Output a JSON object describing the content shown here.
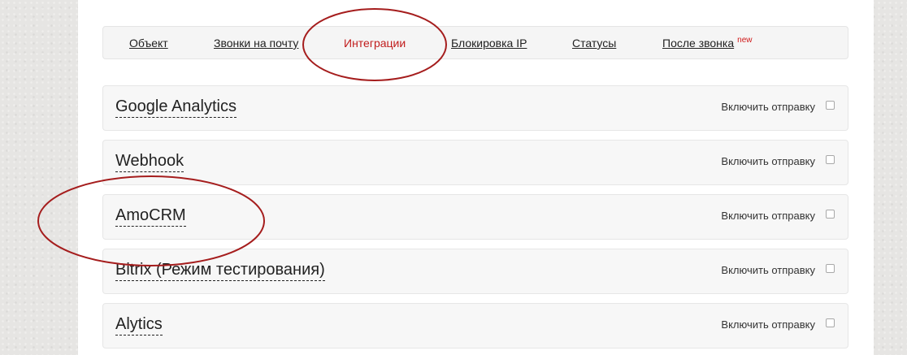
{
  "nav": {
    "tabs": [
      {
        "label": "Объект"
      },
      {
        "label": "Звонки на почту"
      },
      {
        "label": "Интеграции",
        "active": true
      },
      {
        "label": "Блокировка IP"
      },
      {
        "label": "Статусы"
      },
      {
        "label": "После звонка",
        "badge": "new"
      }
    ]
  },
  "integrations": [
    {
      "name": "Google Analytics",
      "toggle_label": "Включить отправку",
      "checked": false
    },
    {
      "name": "Webhook",
      "toggle_label": "Включить отправку",
      "checked": false
    },
    {
      "name": "AmoCRM",
      "toggle_label": "Включить отправку",
      "checked": false
    },
    {
      "name": "Bitrix (Режим тестирования)",
      "toggle_label": "Включить отправку",
      "checked": false
    },
    {
      "name": "Alytics",
      "toggle_label": "Включить отправку",
      "checked": false
    }
  ],
  "colors": {
    "active_tab": "#c11c1c",
    "annotation": "#a51d1d",
    "new_badge": "#d01818"
  }
}
